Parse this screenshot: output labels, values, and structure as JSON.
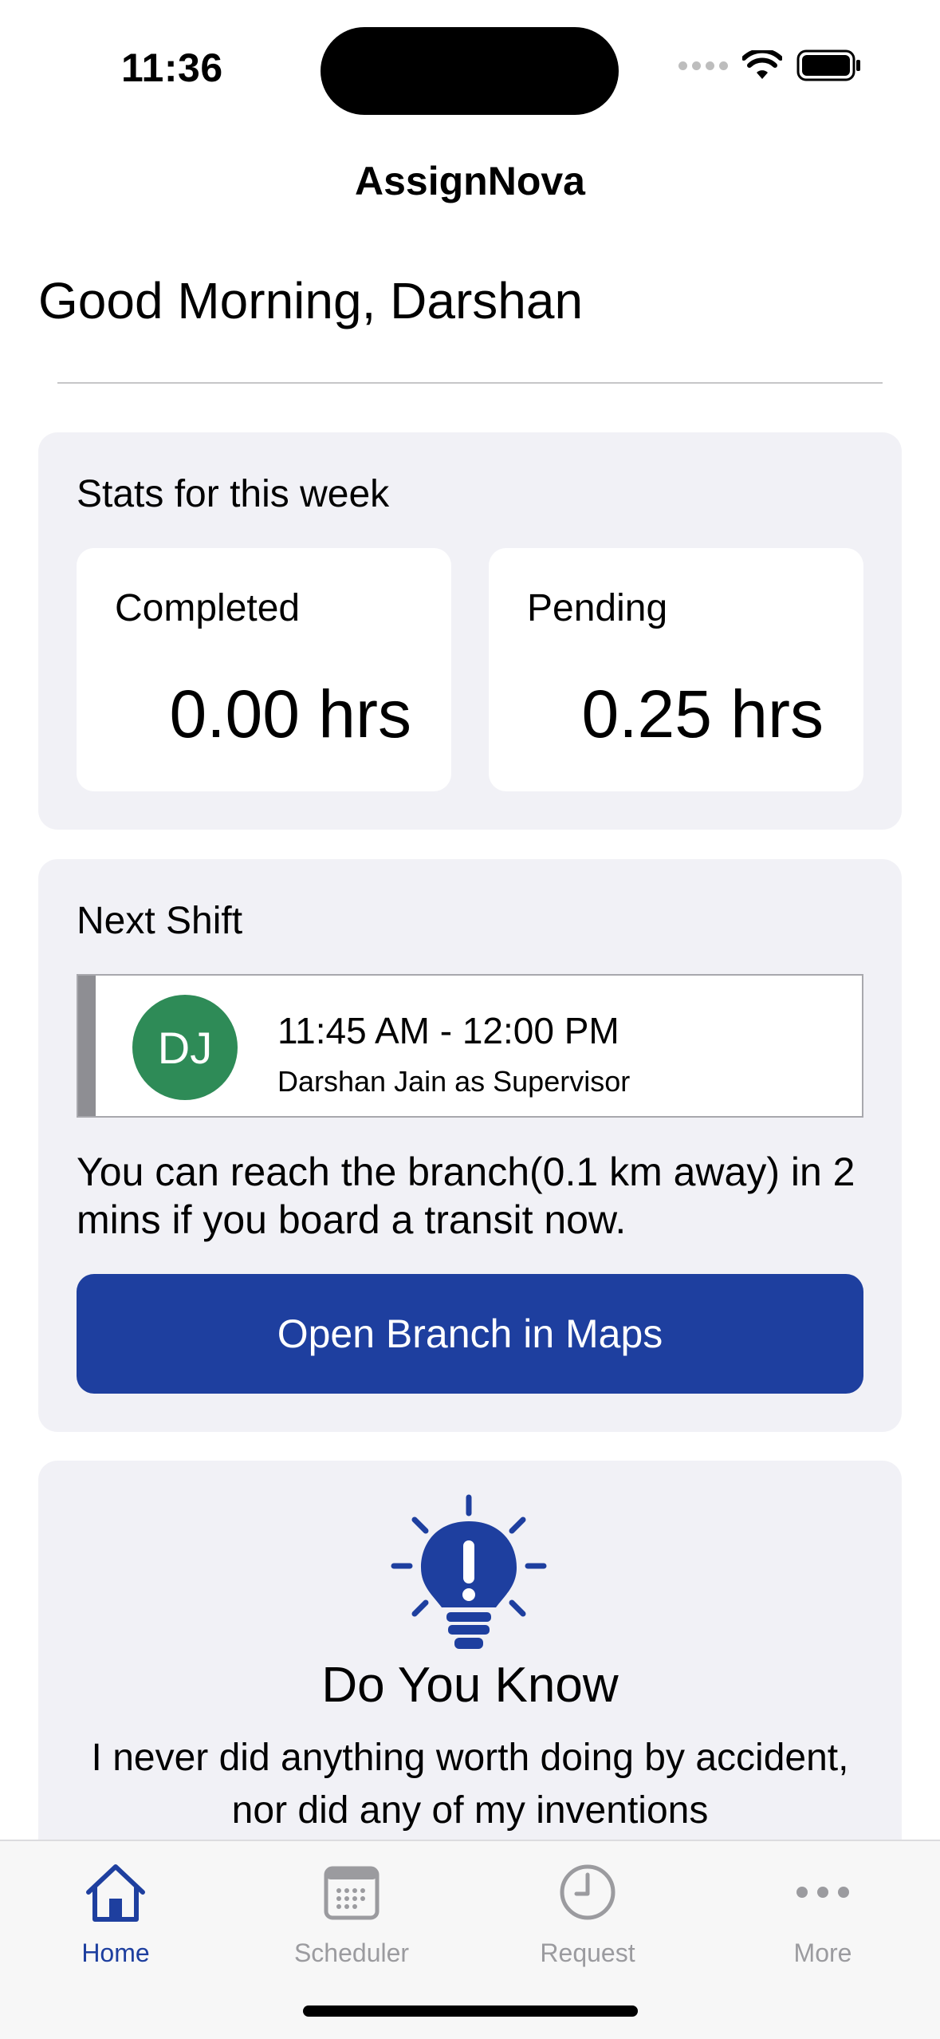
{
  "status_bar": {
    "time": "11:36"
  },
  "nav": {
    "title": "AssignNova"
  },
  "greeting": "Good Morning, Darshan",
  "stats": {
    "heading": "Stats for this week",
    "completed_label": "Completed",
    "completed_value": "0.00 hrs",
    "pending_label": "Pending",
    "pending_value": "0.25 hrs"
  },
  "next_shift": {
    "heading": "Next Shift",
    "avatar_initials": "DJ",
    "avatar_color": "#2e8b57",
    "time": "11:45 AM - 12:00 PM",
    "assignee": "Darshan Jain as Supervisor",
    "transit_text": "You can reach the branch(0.1 km away) in 2 mins if you board a transit now.",
    "maps_button": "Open Branch in Maps"
  },
  "do_you_know": {
    "title": "Do You Know",
    "quote": "I never did anything worth doing by accident, nor did any of my inventions"
  },
  "tabbar": {
    "tabs": [
      {
        "label": "Home",
        "icon": "house-icon",
        "active": true
      },
      {
        "label": "Scheduler",
        "icon": "calendar-icon",
        "active": false
      },
      {
        "label": "Request",
        "icon": "clock-icon",
        "active": false
      },
      {
        "label": "More",
        "icon": "ellipsis-icon",
        "active": false
      }
    ]
  },
  "colors": {
    "accent": "#1e3f9f",
    "card_bg": "#f1f1f6",
    "inactive_tab": "#9b9b9f"
  }
}
